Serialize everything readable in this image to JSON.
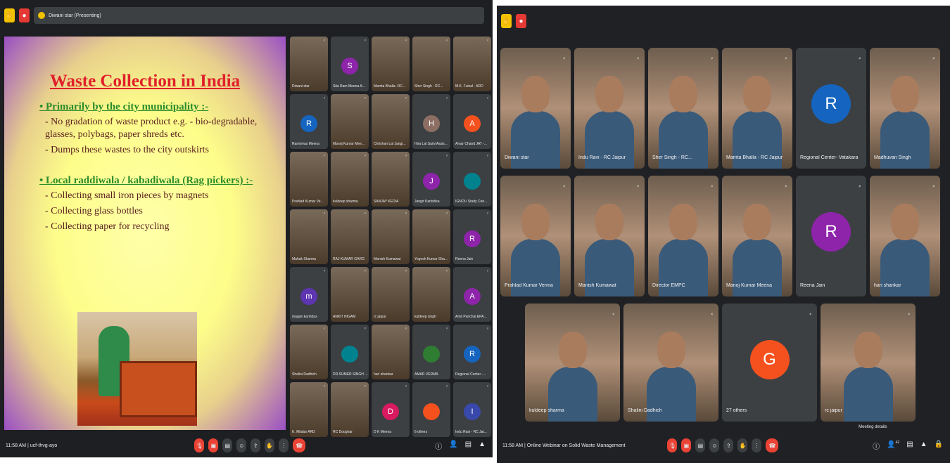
{
  "left": {
    "presenting_label": "Diwani star (Presenting)",
    "slide": {
      "title": "Waste Collection in India",
      "bullet1": "Primarily by the city municipality :-",
      "bullet1_lines": [
        "- No gradation of waste product e.g. - bio-degradable, glasses, polybags, paper shreds etc.",
        "- Dumps these wastes to the city outskirts"
      ],
      "bullet2": "Local raddiwala / kabadiwala (Rag pickers) :-",
      "bullet2_lines": [
        "- Collecting small iron pieces by magnets",
        "- Collecting glass bottles",
        "- Collecting paper for recycling"
      ]
    },
    "tiles": [
      {
        "name": "Diwani star",
        "initial": "",
        "color": "#7a6a5a",
        "video": true
      },
      {
        "name": "Sita Ram Meena A...",
        "initial": "S",
        "color": "#8e24aa"
      },
      {
        "name": "Mamta Bhalla -RC...",
        "initial": "",
        "color": "#6a5a4a",
        "video": true
      },
      {
        "name": "Sher Singh - RC...",
        "initial": "",
        "color": "#6a5a4a",
        "video": true
      },
      {
        "name": "M.K. Fuisal - ARD",
        "initial": "",
        "color": "#6a5a4a",
        "video": true
      },
      {
        "name": "Ramnivas Meena",
        "initial": "R",
        "color": "#1565c0"
      },
      {
        "name": "Manoj Kumar Mee...",
        "initial": "",
        "color": "#6a5a4a",
        "video": true
      },
      {
        "name": "Chrishan Lal Jangi...",
        "initial": "",
        "color": "#6a5a4a",
        "video": true
      },
      {
        "name": "Hira Lal Saini Assis...",
        "initial": "H",
        "color": "#8d6e63"
      },
      {
        "name": "Amar Chand JAT -...",
        "initial": "A",
        "color": "#f4511e"
      },
      {
        "name": "Prahlad Kumar Ve...",
        "initial": "",
        "color": "#6a5a4a",
        "video": true
      },
      {
        "name": "kuldeep sharma",
        "initial": "",
        "color": "#6a5a4a",
        "video": true
      },
      {
        "name": "SANJAY KEDIA",
        "initial": "",
        "color": "#6a5a4a",
        "video": true
      },
      {
        "name": "Jangir Kanishka",
        "initial": "J",
        "color": "#8e24aa"
      },
      {
        "name": "IGNOU Study Cen...",
        "initial": "",
        "color": "#00838f"
      },
      {
        "name": "Mahak Sharma",
        "initial": "",
        "color": "#6a5a4a",
        "video": true
      },
      {
        "name": "RAJ KUMAR GARG",
        "initial": "",
        "color": "#6a5a4a",
        "video": true
      },
      {
        "name": "Manish Kumawat",
        "initial": "",
        "color": "#6a5a4a",
        "video": true
      },
      {
        "name": "Yogesh Kumar Sha...",
        "initial": "",
        "color": "#6a5a4a",
        "video": true
      },
      {
        "name": "Reena Jain",
        "initial": "R",
        "color": "#8e24aa"
      },
      {
        "name": "magan kanhdas",
        "initial": "m",
        "color": "#5e35b1"
      },
      {
        "name": "ANKIT NIGAM",
        "initial": "",
        "color": "#6a5a4a",
        "video": true
      },
      {
        "name": "rc jaipur",
        "initial": "",
        "color": "#6a5a4a",
        "video": true
      },
      {
        "name": "kuldeep singh",
        "initial": "",
        "color": "#6a5a4a",
        "video": true
      },
      {
        "name": "Amit Panchal EPA...",
        "initial": "A",
        "color": "#8e24aa"
      },
      {
        "name": "Shalini Dadhich",
        "initial": "",
        "color": "#6a5a4a",
        "video": true
      },
      {
        "name": "DR.SUMER SINGH ...",
        "initial": "",
        "color": "#00838f"
      },
      {
        "name": "hari shankar",
        "initial": "",
        "color": "#6a5a4a",
        "video": true
      },
      {
        "name": "AMAR VERMA",
        "initial": "",
        "color": "#2e7d32"
      },
      {
        "name": "Regional Center -...",
        "initial": "R",
        "color": "#1565c0"
      },
      {
        "name": "K. Mitalar ARD",
        "initial": "",
        "color": "#6a5a4a",
        "video": true
      },
      {
        "name": "RC Dooghar",
        "initial": "",
        "color": "#6a5a4a",
        "video": true
      },
      {
        "name": "D K Meena",
        "initial": "D",
        "color": "#d81b60"
      },
      {
        "name": "6 others",
        "initial": "",
        "color": "#f4511e"
      },
      {
        "name": "Indu Ravi - RC Jai...",
        "initial": "I",
        "color": "#3949ab"
      }
    ],
    "bottom": {
      "meta": "11:58 AM  |  ucf-thvg-ayo"
    }
  },
  "right": {
    "tiles": [
      {
        "name": "Diwani star",
        "initial": "",
        "video": true
      },
      {
        "name": "Indu Ravi - RC Jaipur",
        "initial": "",
        "video": true
      },
      {
        "name": "Sher Singh - RC...",
        "initial": "",
        "video": true
      },
      {
        "name": "Mamta Bhalla - RC Jaipur",
        "initial": "",
        "video": true
      },
      {
        "name": "Regional Center- Vatakara",
        "initial": "R",
        "color": "#1565c0"
      },
      {
        "name": "Madhuvan Singh",
        "initial": "",
        "video": true
      },
      {
        "name": "Prahlad Kumar Verma",
        "initial": "",
        "video": true
      },
      {
        "name": "Manish Kumawat",
        "initial": "",
        "video": true
      },
      {
        "name": "Director EMPC",
        "initial": "",
        "video": true
      },
      {
        "name": "Manoj Kumar Meena",
        "initial": "",
        "video": true
      },
      {
        "name": "Reena Jain",
        "initial": "R",
        "color": "#8e24aa"
      },
      {
        "name": "hari shankar",
        "initial": "",
        "video": true
      }
    ],
    "tiles_row3": [
      {
        "name": "kuldeep sharma",
        "initial": "",
        "video": true
      },
      {
        "name": "Shalini Dadhich",
        "initial": "",
        "video": true
      },
      {
        "name": "27 others",
        "initial": "G",
        "color": "#f4511e"
      },
      {
        "name": "rc jaipur",
        "initial": "",
        "video": true
      }
    ],
    "bottom": {
      "meta": "11:58 AM  |  Online Webinar on Solid Waste Management",
      "meeting_details": "Meeting details",
      "count": "42"
    }
  }
}
